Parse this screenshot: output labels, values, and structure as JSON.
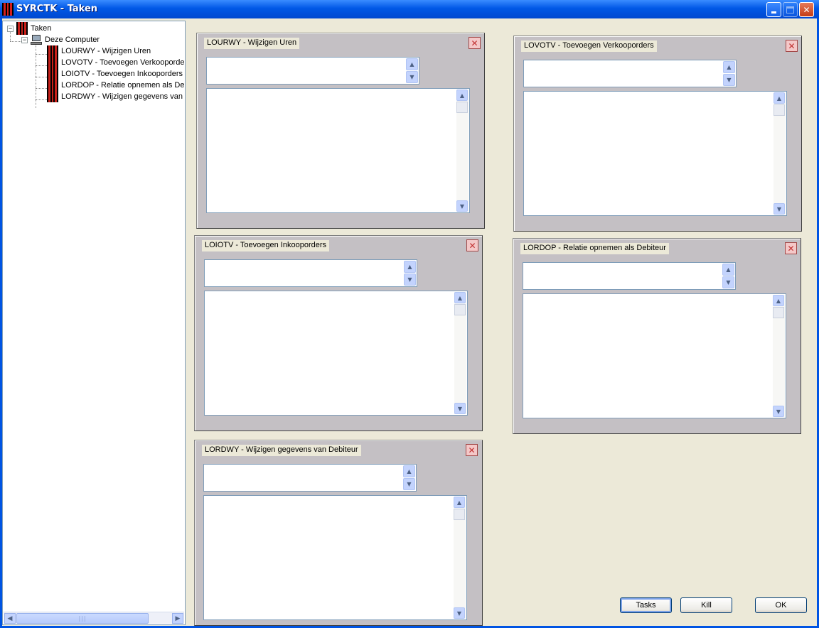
{
  "window": {
    "title": "SYRCTK - Taken"
  },
  "titlebar_buttons": [
    "minimize-icon",
    "maximize-icon",
    "close-icon"
  ],
  "tree": {
    "root": {
      "label": "Taken",
      "expander": "−"
    },
    "computer": {
      "label": "Deze Computer",
      "expander": "−"
    },
    "items": [
      {
        "label": "LOURWY - Wijzigen Uren"
      },
      {
        "label": "LOVOTV - Toevoegen Verkooporde"
      },
      {
        "label": "LOIOTV - Toevoegen Inkooporders"
      },
      {
        "label": "LORDOP - Relatie opnemen als Deb"
      },
      {
        "label": "LORDWY - Wijzigen gegevens van"
      }
    ]
  },
  "panels": [
    {
      "title": "LOURWY - Wijzigen Uren",
      "close": "✕"
    },
    {
      "title": "LOVOTV - Toevoegen Verkooporders",
      "close": "✕"
    },
    {
      "title": "LOIOTV - Toevoegen Inkooporders",
      "close": "✕"
    },
    {
      "title": "LORDOP - Relatie opnemen als Debiteur",
      "close": "✕"
    },
    {
      "title": "LORDWY - Wijzigen gegevens van Debiteur",
      "close": "✕"
    }
  ],
  "buttons": {
    "tasks": "Tasks",
    "kill": "Kill",
    "ok": "OK"
  },
  "glyphs": {
    "up": "▲",
    "down": "▼",
    "left": "◀",
    "right": "▶",
    "grip": "|||"
  }
}
